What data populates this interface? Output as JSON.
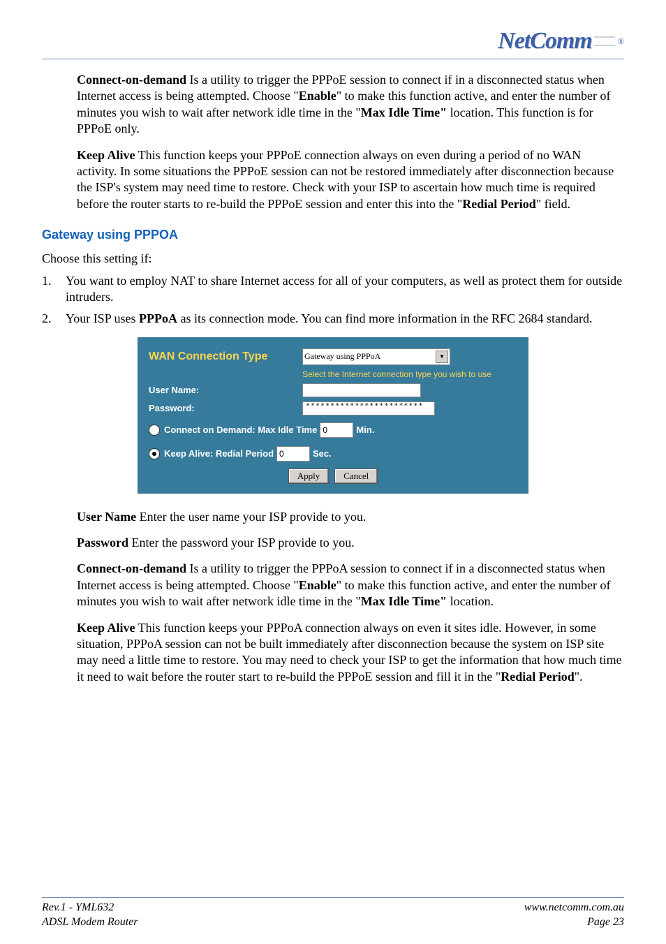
{
  "logo": {
    "text": "NetComm",
    "reg": "®"
  },
  "paragraphs": {
    "p1_a": "Connect-on-demand",
    "p1_b": " Is a utility to trigger the PPPoE session to connect if in a disconnected status when Internet access is being attempted. Choose \"",
    "p1_c": "Enable",
    "p1_d": "\" to make this function active, and enter the number of minutes you wish to wait after network idle time in the \"",
    "p1_e": "Max Idle Time\"",
    "p1_f": " location. This function is for PPPoE only.",
    "p2_a": "Keep Alive",
    "p2_b": " This function keeps your PPPoE connection always on even during a period of no WAN activity. In some situations the PPPoE session can not be restored immediately after disconnection because the ISP's system may need time to restore. Check with your ISP to ascertain how much time is required before the router starts to re-build the PPPoE session and enter this into the \"",
    "p2_c": "Redial Period",
    "p2_d": "\" field."
  },
  "subhead1": "Gateway using PPPOA",
  "intro": "Choose this setting if:",
  "list": {
    "n1": "1.",
    "i1": "You want to employ NAT to share Internet access for all of your computers, as well as protect them for outside intruders.",
    "n2": "2.",
    "i2_a": "Your ISP uses ",
    "i2_b": "PPPoA",
    "i2_c": " as its connection mode. You can find more information in the RFC 2684 standard."
  },
  "panel": {
    "title": "WAN Connection Type",
    "select_value": "Gateway using PPPoA",
    "subinfo": "Select the Internet connection type you wish to use",
    "username_label": "User Name:",
    "username_value": "",
    "password_label": "Password:",
    "password_value": "************************",
    "cod_label": "Connect on Demand: Max Idle Time",
    "cod_value": "0",
    "cod_unit": "Min.",
    "ka_label": "Keep Alive: Redial Period",
    "ka_value": "0",
    "ka_unit": "Sec.",
    "apply": "Apply",
    "cancel": "Cancel"
  },
  "after": {
    "u_a": "User Name",
    "u_b": " Enter the user name your ISP provide to you.",
    "pw_a": "Password",
    "pw_b": " Enter the password your ISP provide to you.",
    "cd_a": "Connect-on-demand",
    "cd_b": " Is a utility to trigger the PPPoA session to connect if in a disconnected status when Internet access is being attempted. Choose \"",
    "cd_c": "Enable",
    "cd_d": "\" to make this function active, and enter the number of minutes you wish to wait after network idle time in the \"",
    "cd_e": "Max Idle Time\"",
    "cd_f": " location.",
    "ka_a": "Keep Alive",
    "ka_b": " This function keeps your PPPoA connection always on even it sites idle. However, in some situation, PPPoA session can not be built immediately after disconnection because the system on ISP site may need a little time to restore. You may need to check your ISP to get the information that how much time it need to wait before the router start to re-build the PPPoE session and fill it in the \"",
    "ka_c": "Redial Period",
    "ka_d": "\"."
  },
  "footer": {
    "left1": "Rev.1 - YML632",
    "left2": "ADSL Modem Router",
    "right1": "www.netcomm.com.au",
    "right2": "Page 23"
  }
}
